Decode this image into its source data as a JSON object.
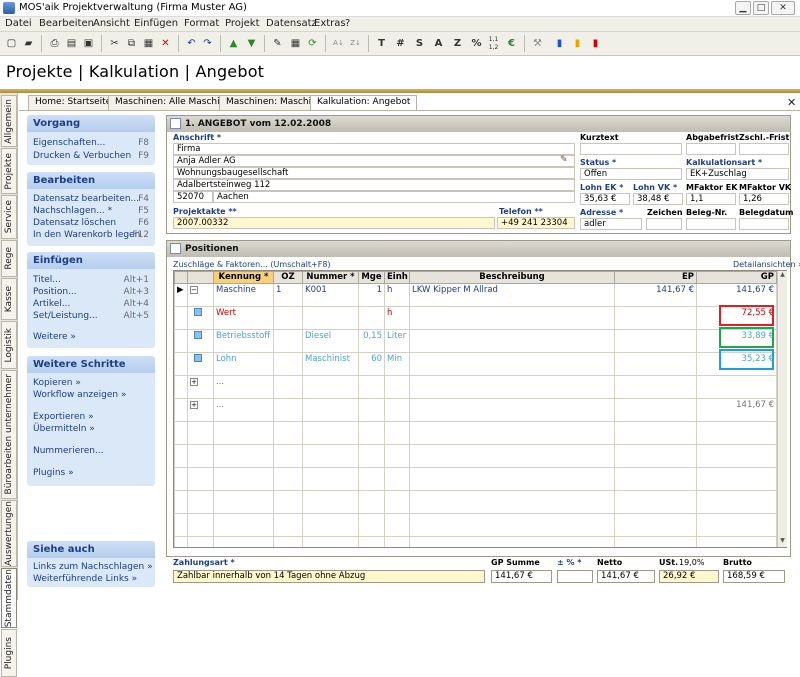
{
  "window": {
    "title": "MOS'aik Projektverwaltung (Firma Muster AG)"
  },
  "menu": [
    "Datei",
    "Bearbeiten",
    "Ansicht",
    "Einfügen",
    "Format",
    "Projekt",
    "Datensatz",
    "Extras",
    "?"
  ],
  "toolbar": {
    "letters": [
      "T",
      "#",
      "S",
      "A",
      "Z",
      "%"
    ],
    "ratio_top": "1,1",
    "ratio_bottom": "1,2"
  },
  "header": {
    "title": "Projekte | Kalkulation | Angebot"
  },
  "vtabs": [
    "Allgemein",
    "Projekte",
    "Service",
    "Rege",
    "Kasse",
    "Logistik",
    "Büroarbeiten unternehmer",
    "Auswertungen",
    "Stammdaten",
    "Plugins"
  ],
  "tabs": [
    "Home: Startseite",
    "Maschinen: Alle Maschinen",
    "Maschinen: Maschine",
    "Kalkulation: Angebot"
  ],
  "sidebar": {
    "vorgang": {
      "title": "Vorgang",
      "items": [
        {
          "label": "Eigenschaften...",
          "key": "F8"
        },
        {
          "label": "Drucken & Verbuchen",
          "key": "F9"
        }
      ]
    },
    "bearbeiten": {
      "title": "Bearbeiten",
      "items": [
        {
          "label": "Datensatz bearbeiten...",
          "key": "F4"
        },
        {
          "label": "Nachschlagen... *",
          "key": "F5"
        },
        {
          "label": "Datensatz löschen",
          "key": "F6"
        },
        {
          "label": "In den Warenkorb legen",
          "key": "F12"
        }
      ]
    },
    "einfuegen": {
      "title": "Einfügen",
      "items": [
        {
          "label": "Titel...",
          "key": "Alt+1"
        },
        {
          "label": "Position...",
          "key": "Alt+3"
        },
        {
          "label": "Artikel...",
          "key": "Alt+4"
        },
        {
          "label": "Set/Leistung...",
          "key": "Alt+5"
        }
      ],
      "more": "Weitere »"
    },
    "weitere": {
      "title": "Weitere Schritte",
      "items": [
        "Kopieren »",
        "Workflow anzeigen »",
        "Exportieren »",
        "Übermitteln »",
        "Nummerieren...",
        "Plugins »"
      ]
    },
    "siehe": {
      "title": "Siehe auch",
      "items": [
        "Links zum Nachschlagen »",
        "Weiterführende Links »"
      ]
    }
  },
  "offer": {
    "title": "1. ANGEBOT vom 12.02.2008",
    "anschrift_label": "Anschrift *",
    "address": [
      "Firma",
      "Anja Adler AG",
      "Wohnungsbaugesellschaft",
      "Adalbertsteinweg 112"
    ],
    "plz": "52070",
    "ort": "Aachen",
    "projektakte_label": "Projektakte **",
    "projektakte": "2007.00332",
    "telefon_label": "Telefon **",
    "telefon": "+49 241 23304",
    "kurztext_label": "Kurztext",
    "abgabefrist_label": "Abgabefrist",
    "zschl_label": "Zschl.-Frist",
    "status_label": "Status *",
    "status": "Offen",
    "kalkart_label": "Kalkulationsart *",
    "kalkart": "EK+Zuschlag",
    "lohnek_label": "Lohn EK *",
    "lohnek": "35,63 €",
    "lohnvk_label": "Lohn VK *",
    "lohnvk": "38,48 €",
    "mfek_label": "MFaktor EK",
    "mfek": "1,1",
    "mfvk_label": "MFaktor VK",
    "mfvk": "1,26",
    "adresse_label": "Adresse *",
    "adresse": "adler",
    "zeichen_label": "Zeichen",
    "belegnr_label": "Beleg-Nr.",
    "belegdatum_label": "Belegdatum"
  },
  "positions": {
    "title": "Positionen",
    "link_left": "Zuschläge & Faktoren... (Umschalt+F8)",
    "link_right": "Detailansichten »",
    "columns": [
      "Kennung *",
      "OZ",
      "Nummer *",
      "Mge",
      "Einh",
      "Beschreibung",
      "EP",
      "GP"
    ],
    "rows": [
      {
        "kennung": "Maschine",
        "oz": "1",
        "nummer": "K001",
        "mge": "1",
        "einh": "h",
        "beschreibung": "LKW Kipper M Allrad",
        "ep": "141,67 €",
        "gp": "141,67 €",
        "style": "blue"
      },
      {
        "kennung": "Wert",
        "oz": "",
        "nummer": "",
        "mge": "",
        "einh": "h",
        "beschreibung": "",
        "ep": "",
        "gp": "72,55 €",
        "style": "red"
      },
      {
        "kennung": "Betriebsstoff",
        "oz": "",
        "nummer": "Diesel",
        "mge": "0,15",
        "einh": "Liter",
        "beschreibung": "",
        "ep": "",
        "gp": "33,89 €",
        "style": "light"
      },
      {
        "kennung": "Lohn",
        "oz": "",
        "nummer": "Maschinist",
        "mge": "60",
        "einh": "Min",
        "beschreibung": "",
        "ep": "",
        "gp": "35,23 €",
        "style": "light"
      },
      {
        "kennung": "...",
        "oz": "",
        "nummer": "",
        "mge": "",
        "einh": "",
        "beschreibung": "",
        "ep": "",
        "gp": "",
        "style": "grey"
      },
      {
        "kennung": "...",
        "oz": "",
        "nummer": "",
        "mge": "",
        "einh": "",
        "beschreibung": "",
        "ep": "",
        "gp": "141,67 €",
        "style": "grey"
      }
    ]
  },
  "footer": {
    "zahlungsart_label": "Zahlungsart *",
    "zahlungsart": "Zahlbar innerhalb von 14 Tagen ohne Abzug",
    "gpsumme_label": "GP Summe",
    "gpsumme": "141,67 €",
    "pct_label": "± % *",
    "pct": "",
    "netto_label": "Netto",
    "netto": "141,67 €",
    "ust_label": "USt.",
    "ust_rate": "19,0%",
    "ust": "26,92 €",
    "brutto_label": "Brutto",
    "brutto": "168,59 €"
  },
  "colors": {
    "accent": "#1d3e8a",
    "sidebar_bg": "#dbe8f8",
    "header_line": "#c3a052",
    "highlight_red": "#e02020",
    "highlight_green": "#22a64a",
    "highlight_blue": "#1aa0e0"
  }
}
